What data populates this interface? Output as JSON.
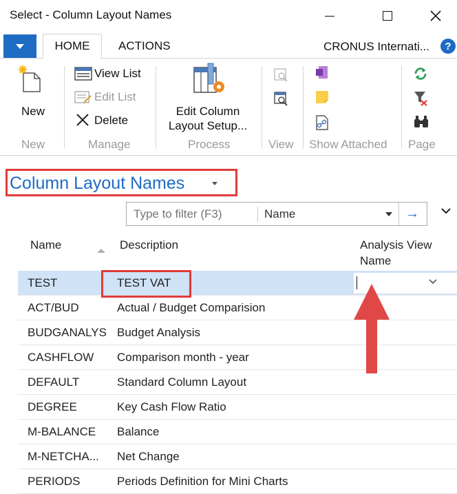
{
  "window": {
    "title": "Select - Column Layout Names"
  },
  "tabs": {
    "home": "HOME",
    "actions": "ACTIONS"
  },
  "company": "CRONUS Internati...",
  "ribbon": {
    "new_label": "New",
    "view_list_label": "View List",
    "edit_list_label": "Edit List",
    "delete_label": "Delete",
    "edit_column_label_1": "Edit Column",
    "edit_column_label_2": "Layout Setup...",
    "groups": {
      "new": "New",
      "manage": "Manage",
      "process": "Process",
      "view": "View",
      "show_attached": "Show Attached",
      "page": "Page"
    }
  },
  "page_title": "Column Layout Names",
  "filter": {
    "placeholder": "Type to filter (F3)",
    "field": "Name"
  },
  "columns": {
    "name": "Name",
    "description": "Description",
    "analysis_view_1": "Analysis View",
    "analysis_view_2": "Name"
  },
  "rows": [
    {
      "name": "TEST",
      "description": "TEST VAT"
    },
    {
      "name": "ACT/BUD",
      "description": "Actual / Budget Comparision"
    },
    {
      "name": "BUDGANALYS",
      "description": "Budget Analysis"
    },
    {
      "name": "CASHFLOW",
      "description": "Comparison month - year"
    },
    {
      "name": "DEFAULT",
      "description": "Standard Column Layout"
    },
    {
      "name": "DEGREE",
      "description": "Key Cash Flow Ratio"
    },
    {
      "name": "M-BALANCE",
      "description": "Balance"
    },
    {
      "name": "M-NETCHA...",
      "description": "Net Change"
    },
    {
      "name": "PERIODS",
      "description": "Periods Definition for Mini Charts"
    }
  ],
  "colors": {
    "accent": "#1e6bc4",
    "selected_row": "#cfe2f6",
    "annotation": "#e03a3a"
  }
}
